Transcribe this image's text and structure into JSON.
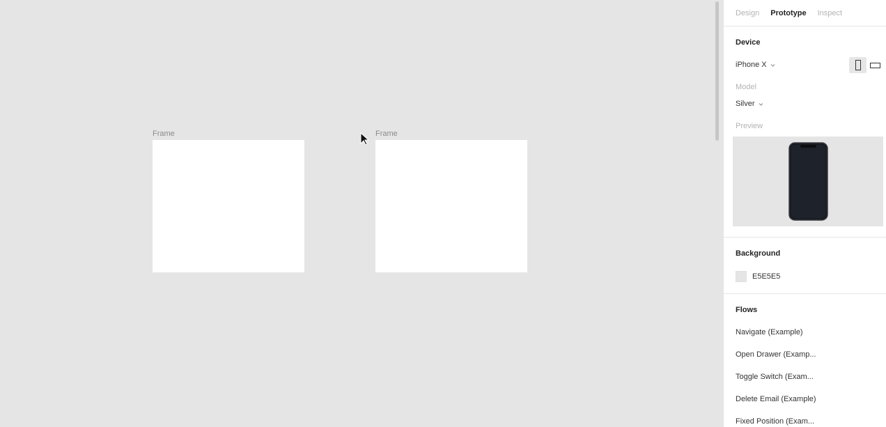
{
  "canvas": {
    "frames": [
      {
        "label": "Frame"
      },
      {
        "label": "Frame"
      }
    ]
  },
  "panel": {
    "tabs": [
      {
        "label": "Design",
        "active": false
      },
      {
        "label": "Prototype",
        "active": true
      },
      {
        "label": "Inspect",
        "active": false
      }
    ],
    "device": {
      "title": "Device",
      "selected": "iPhone X",
      "model_label": "Model",
      "model_value": "Silver",
      "preview_label": "Preview",
      "orientations": [
        "portrait-icon",
        "landscape-icon"
      ]
    },
    "background": {
      "title": "Background",
      "color_hex": "E5E5E5",
      "color": "#e5e5e5"
    },
    "flows": {
      "title": "Flows",
      "items": [
        "Navigate (Example)",
        "Open Drawer (Examp...",
        "Toggle Switch (Exam...",
        "Delete Email (Example)",
        "Fixed Position (Exam..."
      ]
    }
  }
}
